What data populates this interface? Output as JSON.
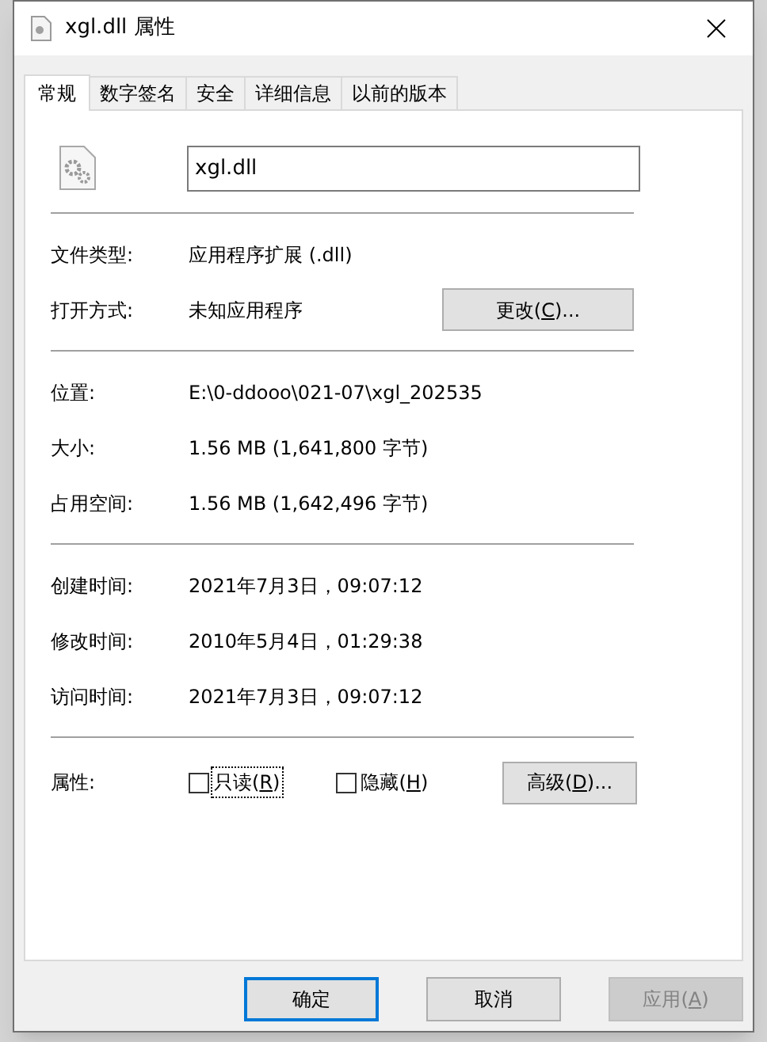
{
  "window": {
    "title": "xgl.dll 属性"
  },
  "tabs": [
    {
      "label": "常规",
      "selected": true
    },
    {
      "label": "数字签名",
      "selected": false
    },
    {
      "label": "安全",
      "selected": false
    },
    {
      "label": "详细信息",
      "selected": false
    },
    {
      "label": "以前的版本",
      "selected": false
    }
  ],
  "file_name": "xgl.dll",
  "sections": [
    [
      {
        "kind": "text",
        "label": "文件类型:",
        "value": "应用程序扩展 (.dll)"
      },
      {
        "kind": "button",
        "label": "打开方式:",
        "value": "未知应用程序",
        "button": {
          "before": "更改(",
          "key": "C",
          "after": ")..."
        }
      }
    ],
    [
      {
        "kind": "text",
        "label": "位置:",
        "value": "E:\\0-ddooo\\021-07\\xgl_202535"
      },
      {
        "kind": "text",
        "label": "大小:",
        "value": "1.56 MB (1,641,800 字节)"
      },
      {
        "kind": "text",
        "label": "占用空间:",
        "value": "1.56 MB (1,642,496 字节)"
      }
    ],
    [
      {
        "kind": "text",
        "label": "创建时间:",
        "value": "2021年7月3日，09:07:12"
      },
      {
        "kind": "text",
        "label": "修改时间:",
        "value": "2010年5月4日，01:29:38"
      },
      {
        "kind": "text",
        "label": "访问时间:",
        "value": "2021年7月3日，09:07:12"
      }
    ]
  ],
  "attributes": {
    "label": "属性:",
    "checkboxes": [
      {
        "before": "只读(",
        "key": "R",
        "after": ")",
        "checked": false,
        "focused": true
      },
      {
        "before": "隐藏(",
        "key": "H",
        "after": ")",
        "checked": false,
        "focused": false
      }
    ],
    "advanced_button": {
      "before": "高级(",
      "key": "D",
      "after": ")..."
    }
  },
  "buttons": [
    {
      "before": "确定",
      "default": true,
      "disabled": false
    },
    {
      "before": "取消",
      "default": false,
      "disabled": false
    },
    {
      "before": "应用(",
      "key": "A",
      "after": ")",
      "default": false,
      "disabled": true
    }
  ]
}
